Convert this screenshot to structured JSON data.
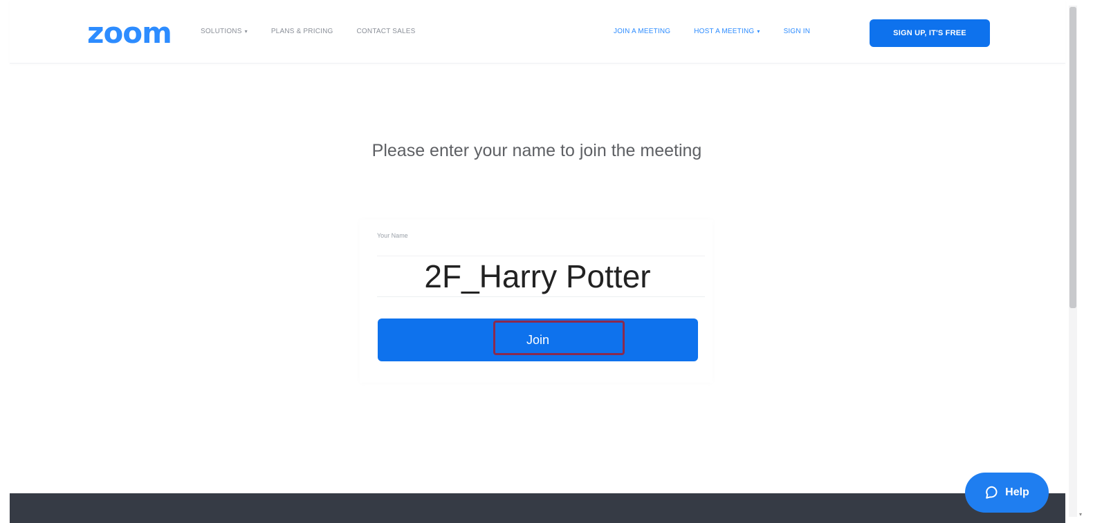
{
  "header": {
    "logo": "zoom",
    "nav_left": [
      "SOLUTIONS",
      "PLANS & PRICING",
      "CONTACT SALES"
    ],
    "nav_right": [
      "JOIN A MEETING",
      "HOST A MEETING",
      "SIGN IN"
    ],
    "signup": "SIGN UP, IT'S FREE"
  },
  "main": {
    "prompt": "Please enter your name to join the meeting",
    "name_label": "Your Name",
    "name_value": "2F_Harry Potter",
    "join_label": "Join"
  },
  "help": {
    "label": "Help"
  },
  "colors": {
    "brand_blue": "#2d8cff",
    "button_blue": "#0e72ed",
    "highlight": "#8b2a4e",
    "footer": "#363b45"
  }
}
